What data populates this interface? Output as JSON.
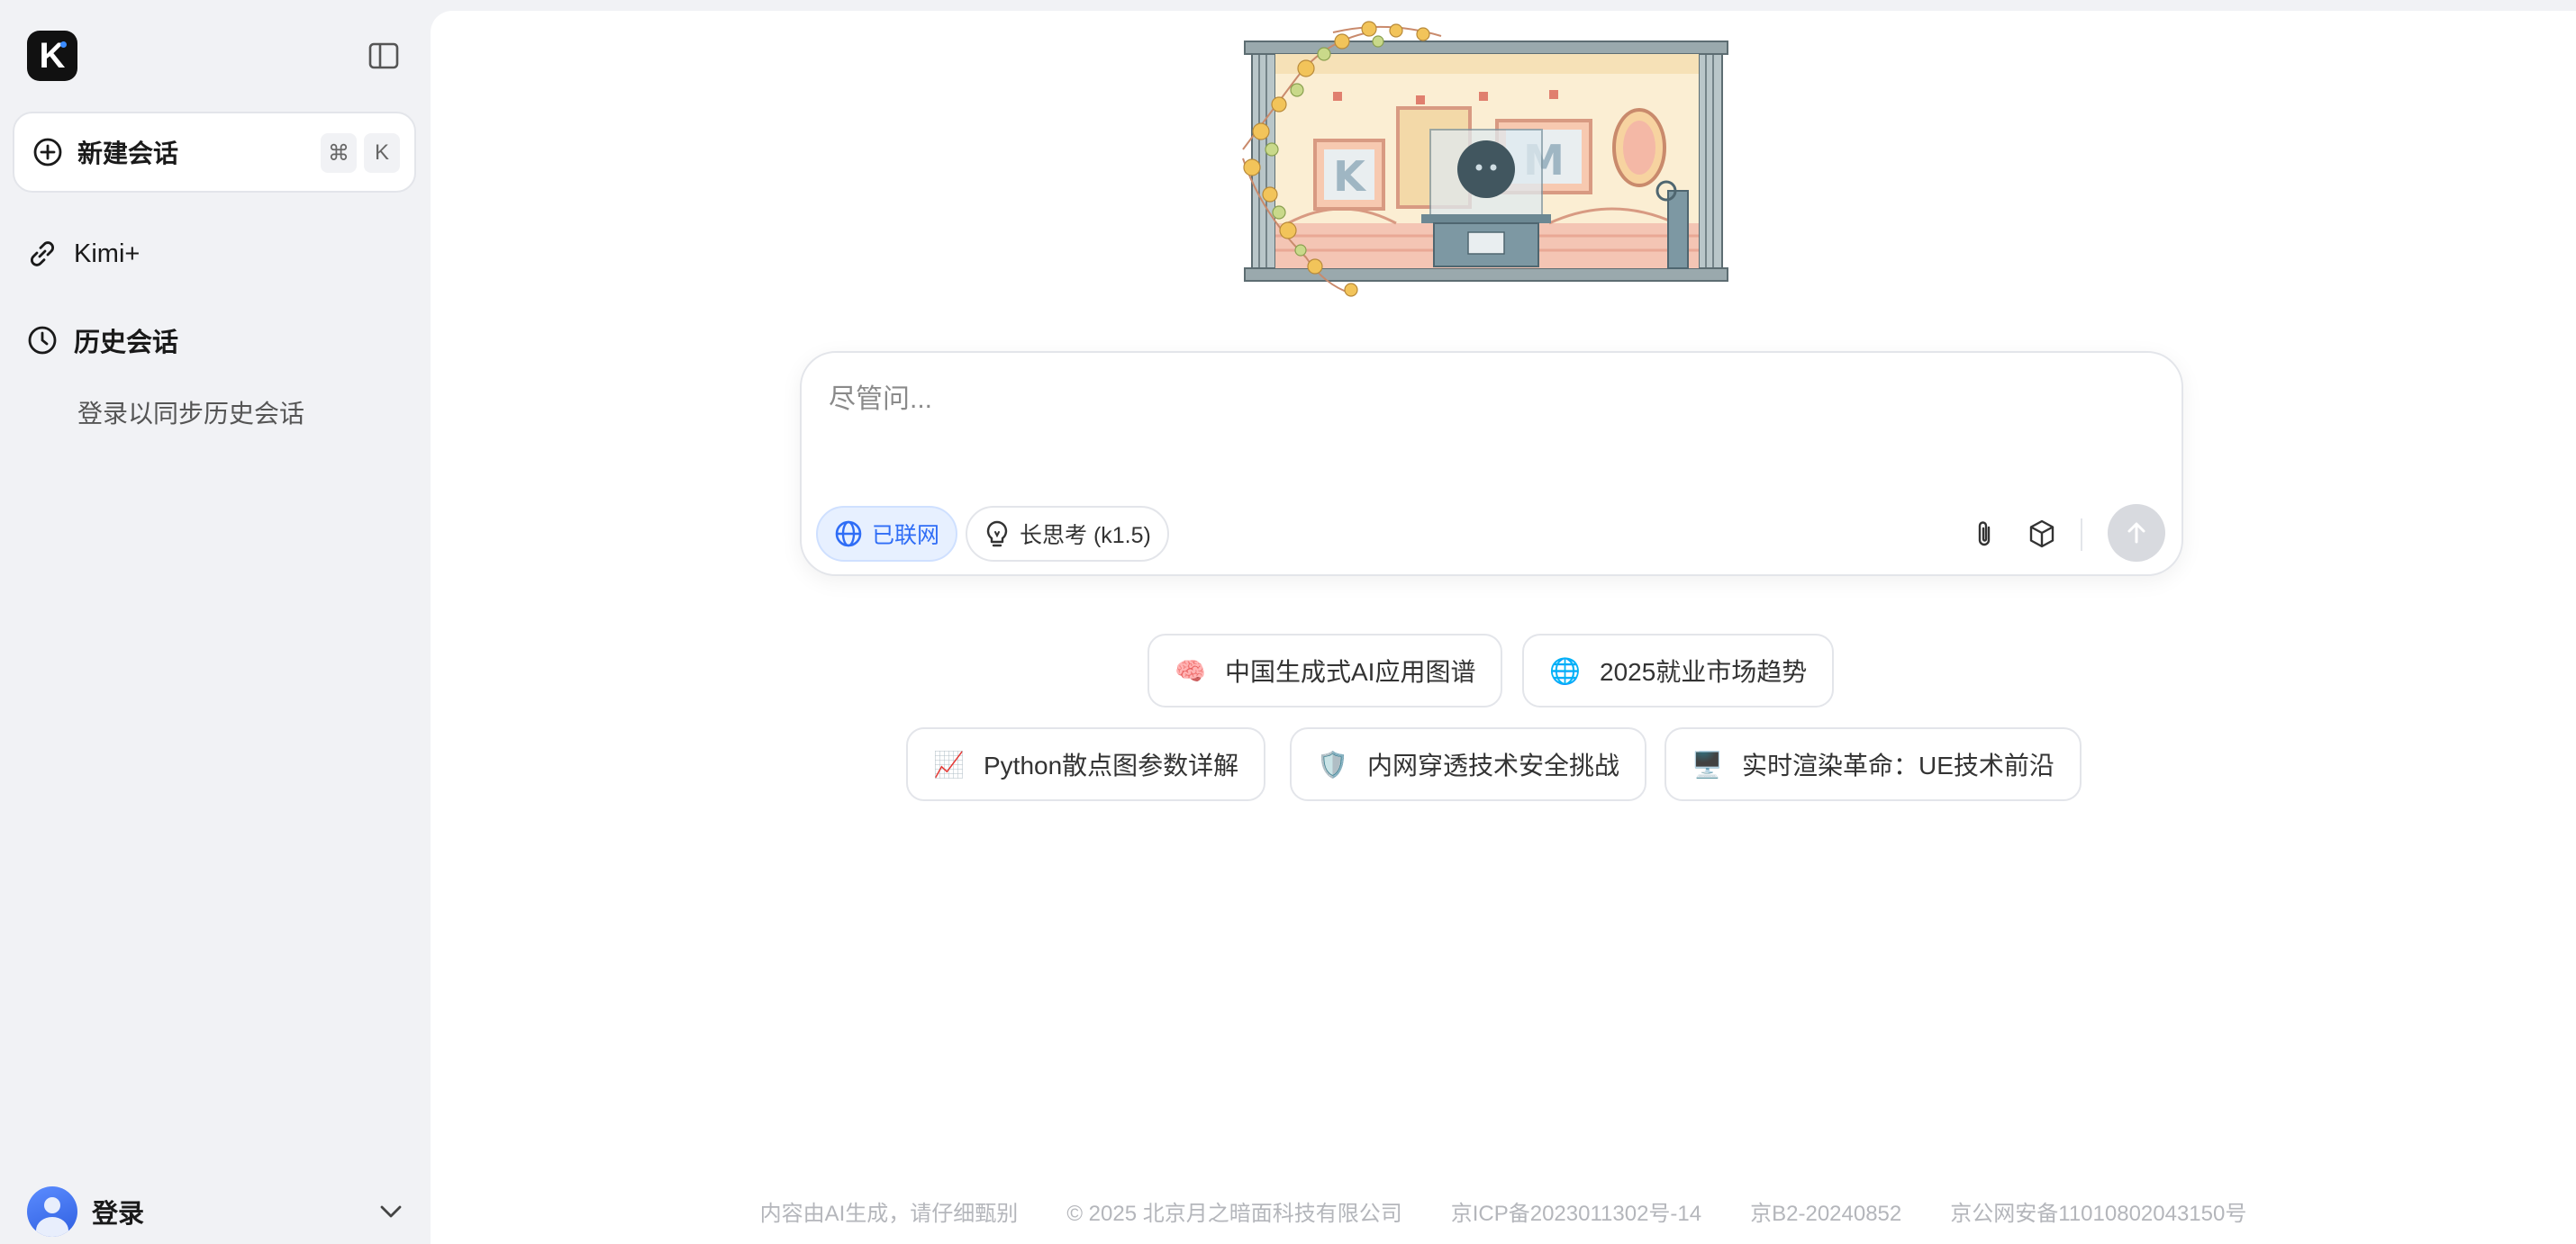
{
  "sidebar": {
    "logo_letter": "K",
    "new_chat": {
      "label": "新建会话",
      "shortcut": [
        "⌘",
        "K"
      ]
    },
    "nav": {
      "kimi_plus": "Kimi+",
      "history": "历史会话"
    },
    "history_hint": "登录以同步历史会话",
    "login": {
      "label": "登录"
    }
  },
  "composer": {
    "placeholder": "尽管问...",
    "value": "",
    "web_chip": "已联网",
    "think_chip": "长思考 (k1.5)"
  },
  "suggestions": [
    {
      "emoji": "🧠",
      "label": "中国生成式AI应用图谱"
    },
    {
      "emoji": "🌐",
      "label": "2025就业市场趋势"
    },
    {
      "emoji": "📈",
      "label": "Python散点图参数详解"
    },
    {
      "emoji": "🛡️",
      "label": "内网穿透技术安全挑战"
    },
    {
      "emoji": "🖥️",
      "label": "实时渲染革命：UE技术前沿"
    }
  ],
  "footer": [
    "内容由AI生成，请仔细甄别",
    "© 2025 北京月之暗面科技有限公司",
    "京ICP备2023011302号-14",
    "京B2-20240852",
    "京公网安备11010802043150号"
  ],
  "colors": {
    "accent": "#2f6df6",
    "sidebar_bg": "#f1f2f5",
    "border": "#e3e5ea",
    "send_disabled": "#d8dadf"
  },
  "icons": {
    "new_chat": "plus-circle-icon",
    "kimi_plus": "link-icon",
    "history": "clock-icon",
    "web": "globe-icon",
    "think": "lightbulb-icon",
    "attach": "paperclip-icon",
    "box": "cube-icon",
    "send": "arrow-up-icon"
  }
}
